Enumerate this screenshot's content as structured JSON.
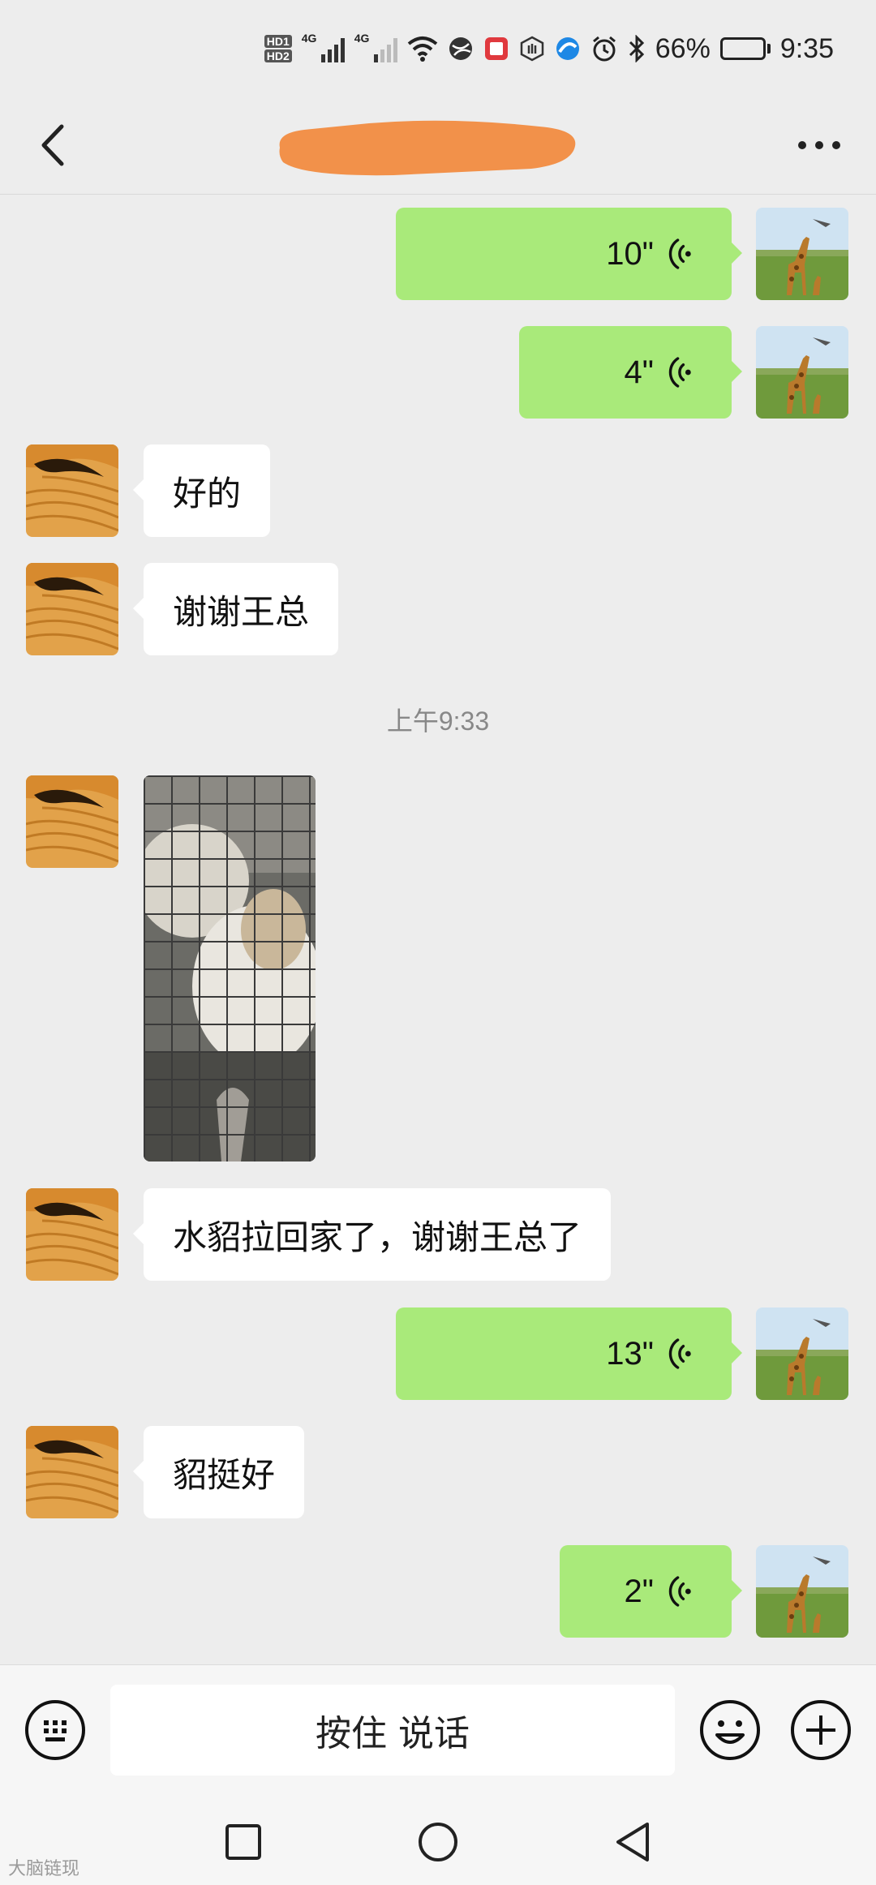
{
  "status_bar": {
    "hd1": "HD1",
    "hd2": "HD2",
    "net1": "4G",
    "net2": "4G",
    "battery": "66%",
    "battery_level": 0.66,
    "time": "9:35"
  },
  "input_bar": {
    "push_to_talk": "按住 说话"
  },
  "messages": {
    "m1": {
      "type": "voice",
      "duration": "10\""
    },
    "m2": {
      "type": "voice",
      "duration": "4\""
    },
    "m3": {
      "type": "text",
      "text": "好的"
    },
    "m4": {
      "type": "text",
      "text": "谢谢王总"
    },
    "ts1": "上午9:33",
    "m5": {
      "type": "image",
      "description_icon": "photo-thumbnail"
    },
    "m6": {
      "type": "text",
      "text": "水貂拉回家了，谢谢王总了"
    },
    "m7": {
      "type": "voice",
      "duration": "13\""
    },
    "m8": {
      "type": "text",
      "text": "貂挺好"
    },
    "m9": {
      "type": "voice",
      "duration": "2\""
    }
  },
  "watermark": "大脑链现",
  "colors": {
    "background": "#ededed",
    "outgoing_bubble": "#a9ea7a",
    "incoming_bubble": "#ffffff",
    "redaction": "#f2914a"
  },
  "icons": {
    "back": "chevron-left-icon",
    "more": "more-dots-icon",
    "keyboard": "keyboard-icon",
    "emoji": "emoji-icon",
    "add": "plus-circle-icon",
    "voice": "voice-wave-icon"
  }
}
